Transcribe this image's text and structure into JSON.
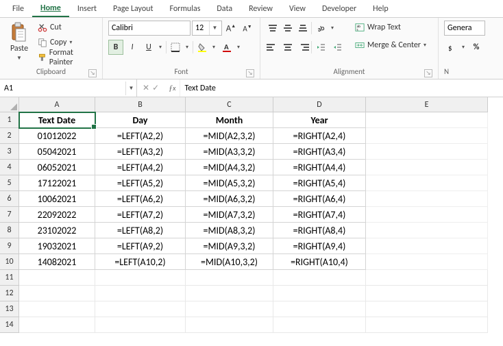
{
  "menu": {
    "tabs": [
      "File",
      "Home",
      "Insert",
      "Page Layout",
      "Formulas",
      "Data",
      "Review",
      "View",
      "Developer",
      "Help"
    ],
    "active": "Home"
  },
  "clipboard": {
    "paste": "Paste",
    "cut": "Cut",
    "copy": "Copy",
    "format_painter": "Format Painter",
    "group_label": "Clipboard"
  },
  "font": {
    "name": "Calibri",
    "size": "12",
    "bold": "B",
    "italic": "I",
    "underline": "U",
    "group_label": "Font"
  },
  "alignment": {
    "wrap": "Wrap Text",
    "merge": "Merge & Center",
    "group_label": "Alignment"
  },
  "number": {
    "format": "General",
    "group_label": "N"
  },
  "namebox": {
    "ref": "A1"
  },
  "formula": {
    "value": "Text Date"
  },
  "columns": [
    "A",
    "B",
    "C",
    "D",
    "E"
  ],
  "headers": {
    "a": "Text Date",
    "b": "Day",
    "c": "Month",
    "d": "Year"
  },
  "rows": [
    {
      "n": "2",
      "a": "01012022",
      "b": "=LEFT(A2,2)",
      "c": "=MID(A2,3,2)",
      "d": "=RIGHT(A2,4)"
    },
    {
      "n": "3",
      "a": "05042021",
      "b": "=LEFT(A3,2)",
      "c": "=MID(A3,3,2)",
      "d": "=RIGHT(A3,4)"
    },
    {
      "n": "4",
      "a": "06052021",
      "b": "=LEFT(A4,2)",
      "c": "=MID(A4,3,2)",
      "d": "=RIGHT(A4,4)"
    },
    {
      "n": "5",
      "a": "17122021",
      "b": "=LEFT(A5,2)",
      "c": "=MID(A5,3,2)",
      "d": "=RIGHT(A5,4)"
    },
    {
      "n": "6",
      "a": "10062021",
      "b": "=LEFT(A6,2)",
      "c": "=MID(A6,3,2)",
      "d": "=RIGHT(A6,4)"
    },
    {
      "n": "7",
      "a": "22092022",
      "b": "=LEFT(A7,2)",
      "c": "=MID(A7,3,2)",
      "d": "=RIGHT(A7,4)"
    },
    {
      "n": "8",
      "a": "23102022",
      "b": "=LEFT(A8,2)",
      "c": "=MID(A8,3,2)",
      "d": "=RIGHT(A8,4)"
    },
    {
      "n": "9",
      "a": "19032021",
      "b": "=LEFT(A9,2)",
      "c": "=MID(A9,3,2)",
      "d": "=RIGHT(A9,4)"
    },
    {
      "n": "10",
      "a": "14082021",
      "b": "=LEFT(A10,2)",
      "c": "=MID(A10,3,2)",
      "d": "=RIGHT(A10,4)"
    }
  ],
  "empty_rows": [
    "11",
    "12",
    "13",
    "14"
  ]
}
